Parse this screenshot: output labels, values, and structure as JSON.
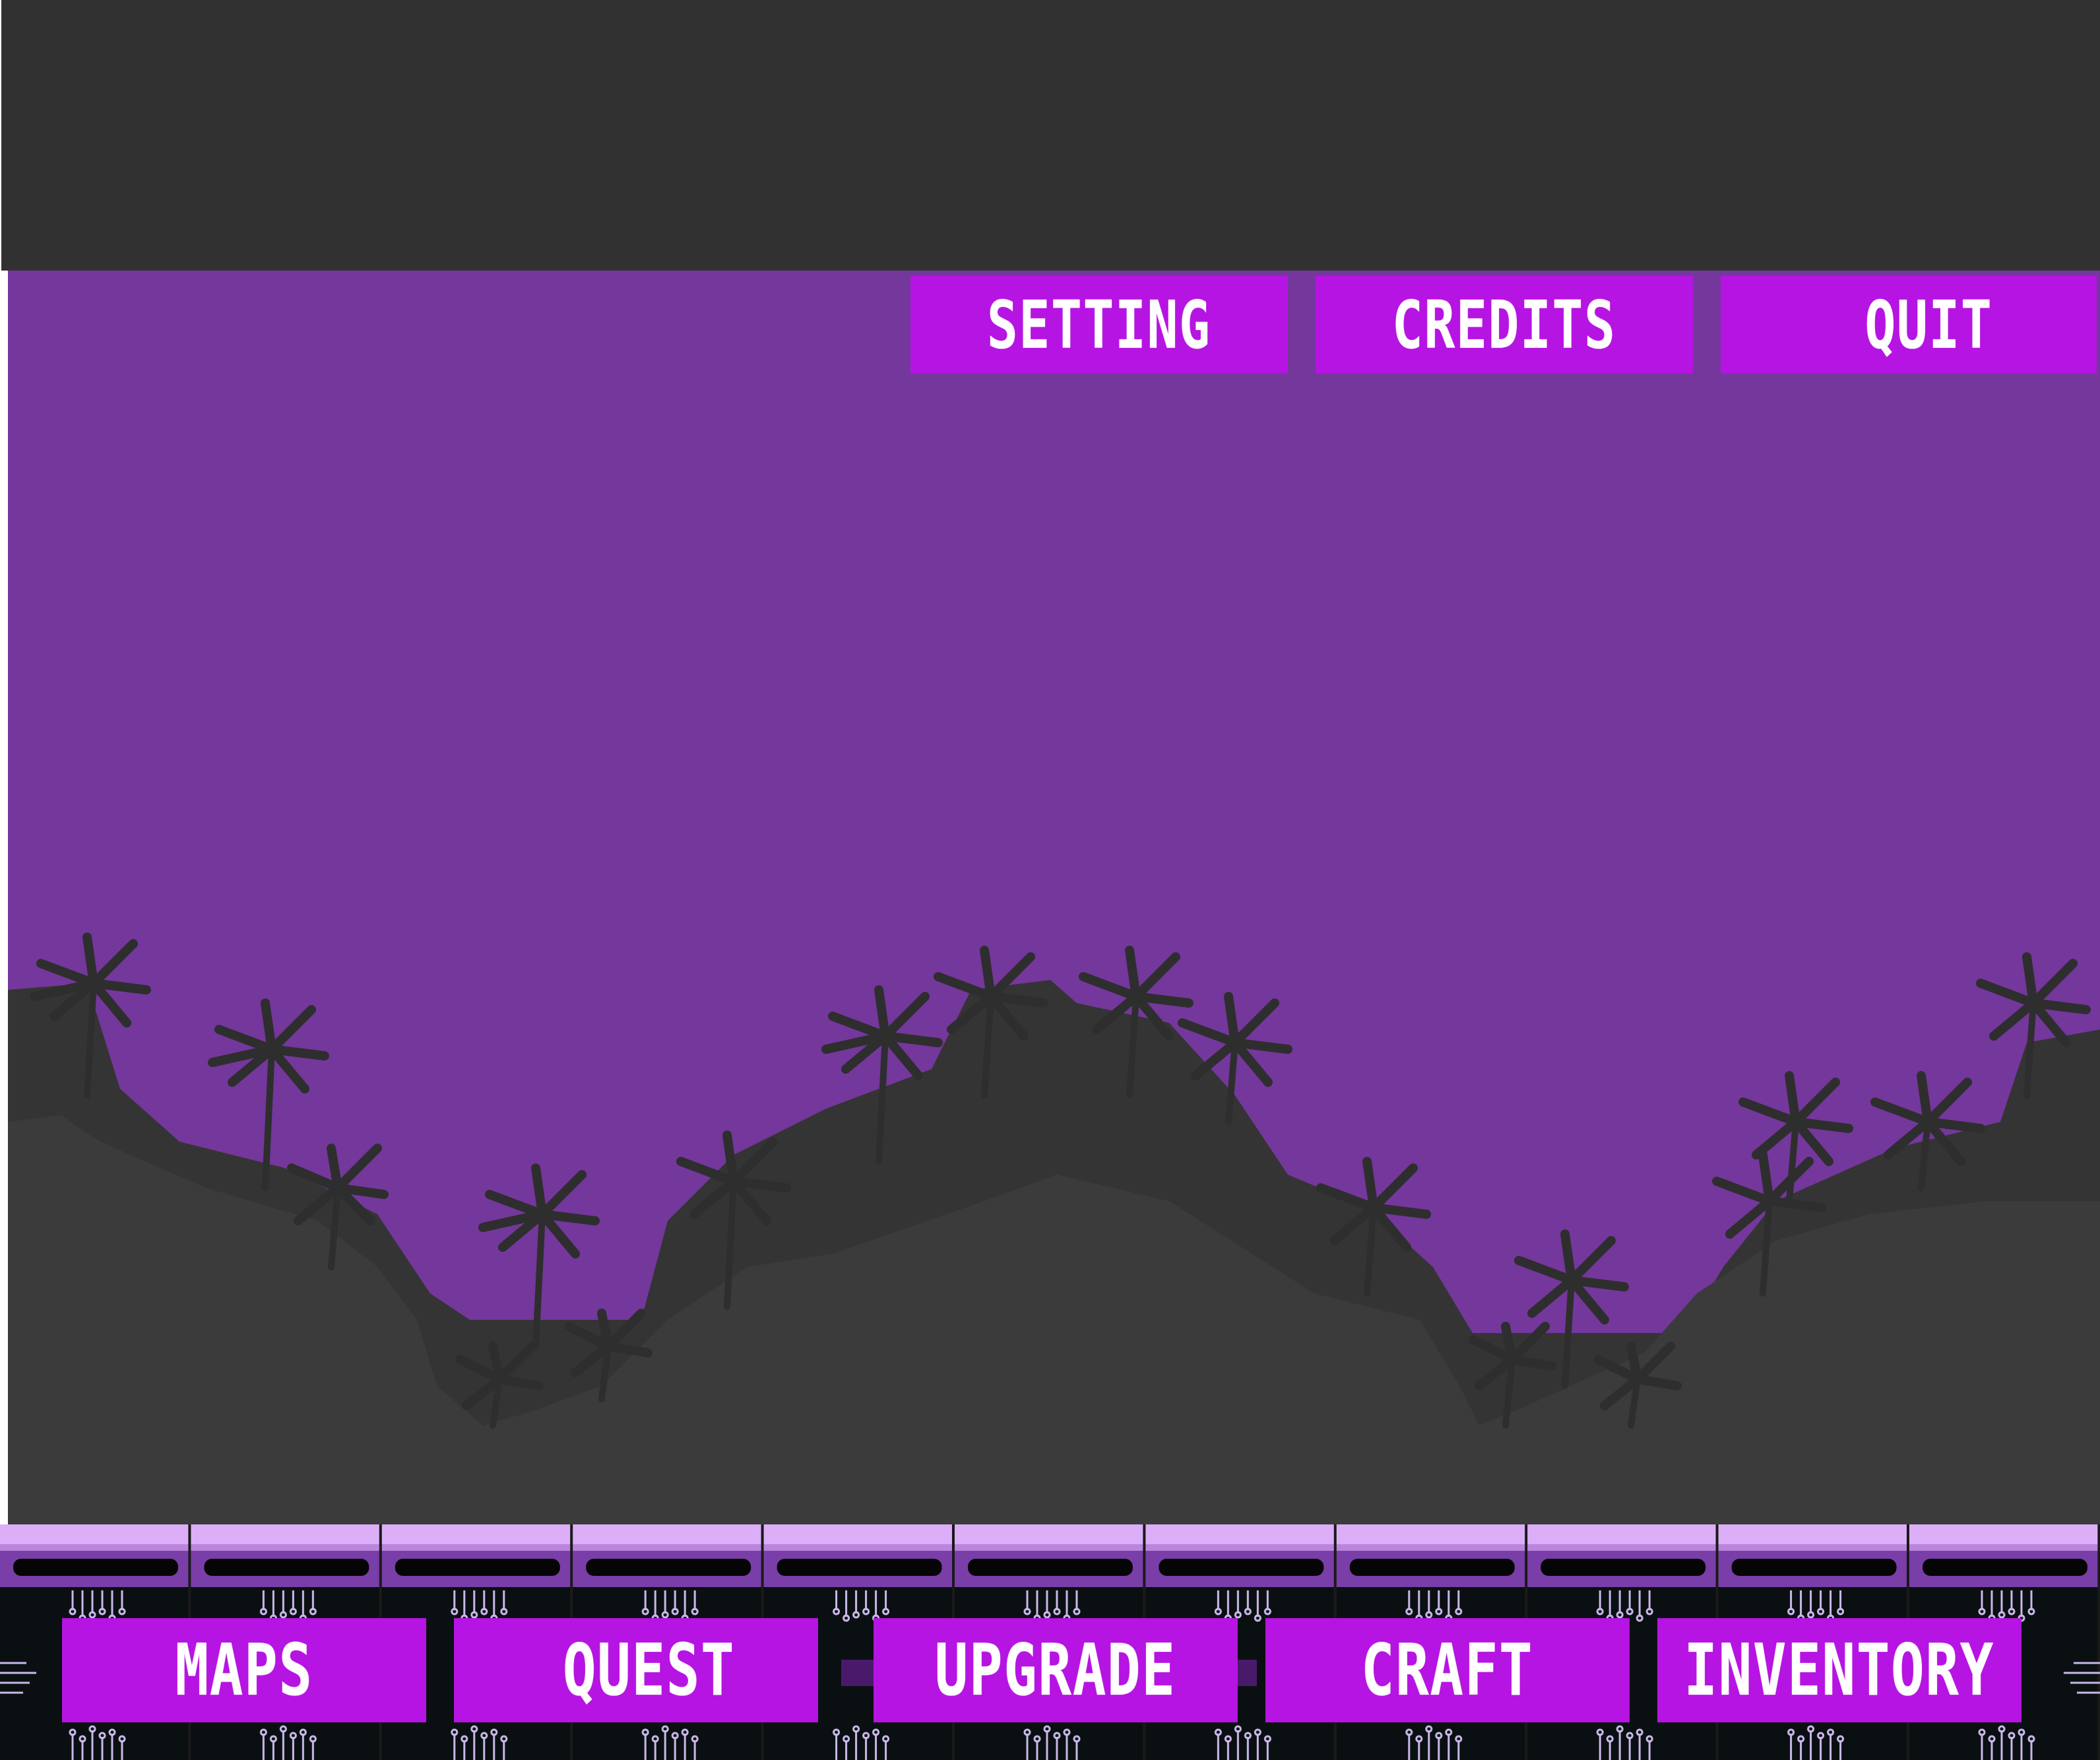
{
  "top_menu": {
    "setting_label": "SETTING",
    "credits_label": "CREDITS",
    "quit_label": "QUIT"
  },
  "bottom_menu": {
    "maps_label": "MAPS",
    "quest_label": "QUEST",
    "upgrade_label": "UPGRADE",
    "craft_label": "CRAFT",
    "inventory_label": "INVENTORY"
  },
  "colors": {
    "top_bar": "#313131",
    "sky": "#74379c",
    "hills": "#3a3a3a",
    "button": "#b614e2",
    "button_text": "#ffffff",
    "floor_rail": "#dcaef7",
    "floor_band": "#7a3ea8",
    "panel": "#0a1012",
    "circuit": "#c9b8e8"
  }
}
